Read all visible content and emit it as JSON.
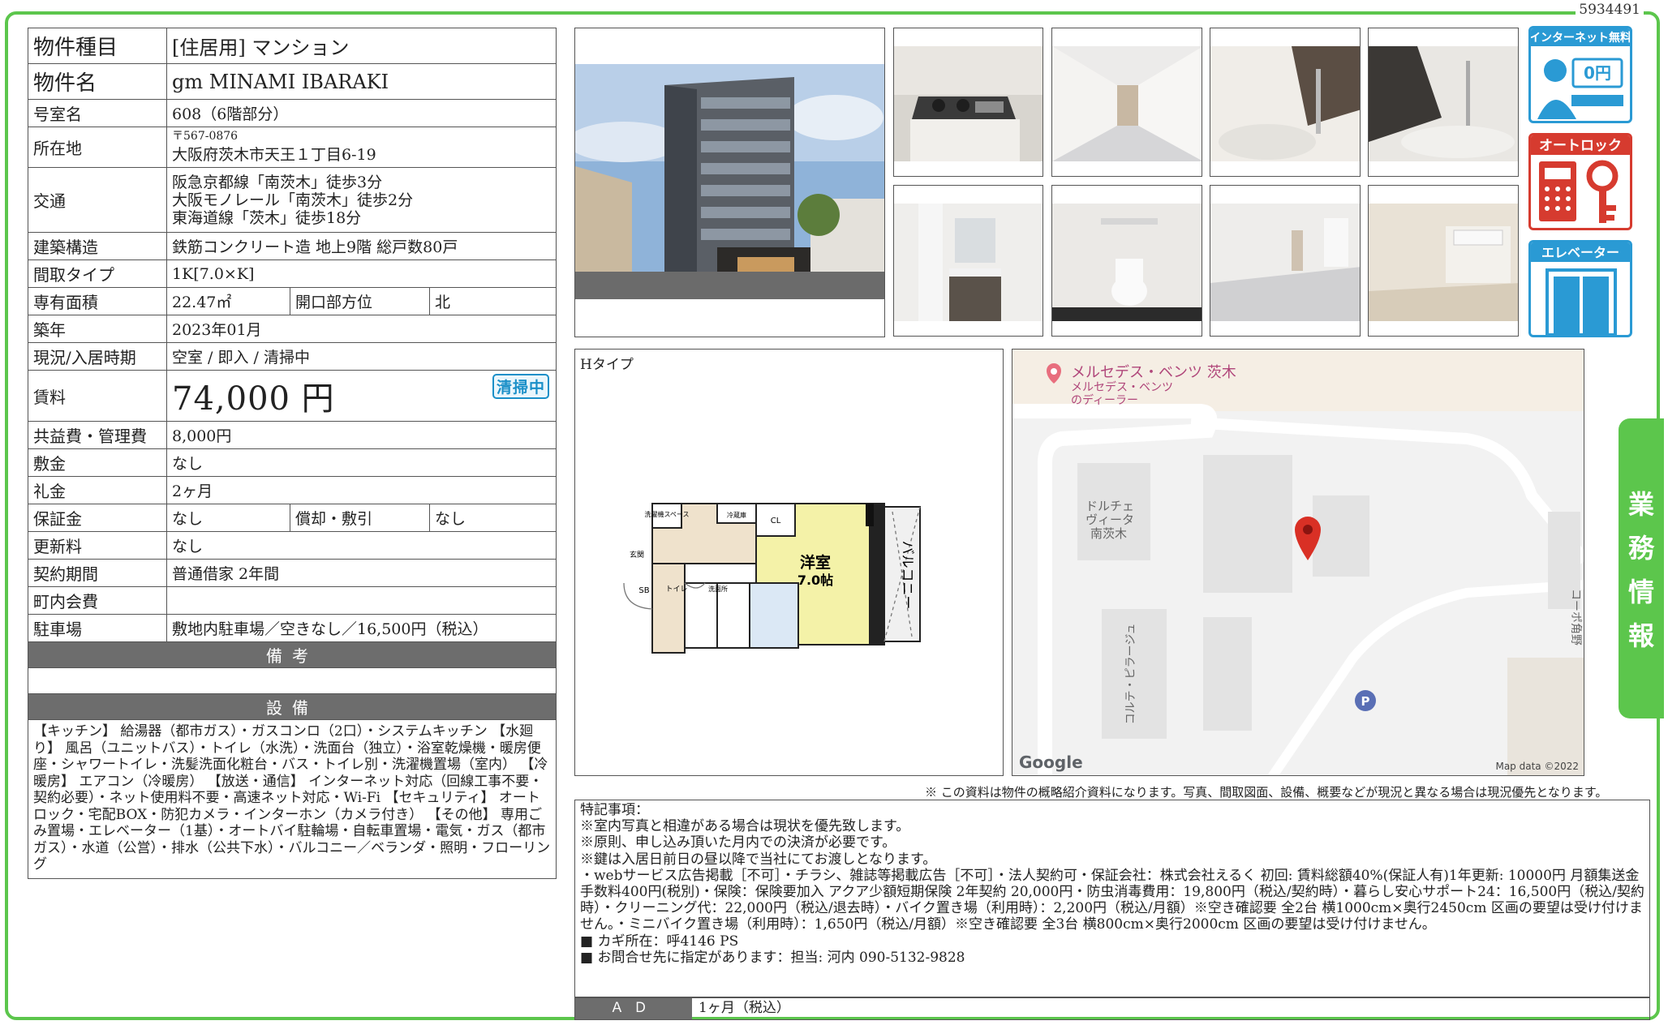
{
  "doc_id": "5934491",
  "spec": {
    "property_type": {
      "label": "物件種目",
      "value": "[住居用] マンション"
    },
    "name": {
      "label": "物件名",
      "value": "gm MINAMI IBARAKI"
    },
    "room_no": {
      "label": "号室名",
      "value": "608（6階部分）"
    },
    "address": {
      "label": "所在地",
      "zip": "〒567-0876",
      "value": "大阪府茨木市天王１丁目6-19"
    },
    "access": {
      "label": "交通",
      "lines": [
        "阪急京都線「南茨木」徒歩3分",
        "大阪モノレール「南茨木」徒歩2分",
        "東海道線「茨木」徒歩18分"
      ]
    },
    "structure": {
      "label": "建築構造",
      "value": "鉄筋コンクリート造 地上9階 総戸数80戸"
    },
    "layout": {
      "label": "間取タイプ",
      "value": "1K[7.0×K]"
    },
    "area": {
      "label": "専有面積",
      "value": "22.47㎡",
      "sub_label": "開口部方位",
      "sub_value": "北"
    },
    "built": {
      "label": "築年",
      "value": "2023年01月"
    },
    "status": {
      "label": "現況/入居時期",
      "value": "空室 / 即入 / 清掃中"
    },
    "rent": {
      "label": "賃料",
      "value": "74,000 円",
      "badge": "清掃中"
    },
    "common_fee": {
      "label": "共益費・管理費",
      "value": "8,000円"
    },
    "deposit": {
      "label": "敷金",
      "value": "なし"
    },
    "key_money": {
      "label": "礼金",
      "value": "2ヶ月"
    },
    "guarantee": {
      "label": "保証金",
      "value": "なし",
      "sub_label": "償却・敷引",
      "sub_value": "なし"
    },
    "renewal": {
      "label": "更新料",
      "value": "なし"
    },
    "contract": {
      "label": "契約期間",
      "value": "普通借家 2年間"
    },
    "community_fee": {
      "label": "町内会費",
      "value": ""
    },
    "parking": {
      "label": "駐車場",
      "value": "敷地内駐車場／空きなし／16,500円（税込）"
    },
    "remarks_header": "備考",
    "equipment_header": "設備",
    "equipment": "【キッチン】 給湯器（都市ガス）・ガスコンロ（2口）・システムキッチン 【水廻り】 風呂（ユニットバス）・トイレ（水洗）・洗面台（独立）・浴室乾燥機・暖房便座・シャワートイレ・洗髪洗面化粧台・バス・トイレ別・洗濯機置場（室内） 【冷暖房】 エアコン（冷暖房） 【放送・通信】 インターネット対応（回線工事不要・契約必要）・ネット使用料不要・高速ネット対応・Wi-Fi 【セキュリティ】 オートロック・宅配BOX・防犯カメラ・インターホン（カメラ付き） 【その他】 専用ごみ置場・エレベーター（1基）・オートバイ駐輪場・自転車置場・電気・ガス（都市ガス）・水道（公営）・排水（公共下水）・バルコニー／ベランダ・照明・フローリング"
  },
  "icons": {
    "internet": {
      "title": "インターネット無料",
      "price": "0円"
    },
    "autolock": {
      "title": "オートロック"
    },
    "elevator": {
      "title": "エレベーター"
    }
  },
  "floor_plan": {
    "type_label": "Hタイプ",
    "room_label": "洋室",
    "room_size": "7.0帖",
    "balcony": "バルコニー",
    "labels": {
      "laundry": "洗濯機スペース",
      "fridge": "冷蔵庫",
      "closet": "CL",
      "entrance": "玄関",
      "shoebox": "SB",
      "toilet": "トイレ",
      "washroom": "洗面所"
    }
  },
  "map": {
    "poi_dealer": "メルセデス・ベンツ 茨木",
    "poi_dealer_sub1": "メルセデス・ベンツ",
    "poi_dealer_sub2": "のディーラー",
    "bldg1": [
      "ドルチェ",
      "ヴィータ",
      "南茨木"
    ],
    "bldg2": "コルテ・ピラージュ",
    "bldg3": "コーポ角野",
    "google": "Google",
    "attribution": "Map data ©2022",
    "marker_color": "#d93025",
    "parking_color": "#5a6fb5"
  },
  "disclaimer": "※ この資料は物件の概略紹介資料になります。写真、間取図面、設備、概要などが現況と異なる場合は現況優先となります。",
  "notes": {
    "lines": [
      "特記事項：",
      "※室内写真と相違がある場合は現状を優先致します。",
      "※原則、申し込み頂いた月内での決済が必要です。",
      "※鍵は入居日前日の昼以降で当社にてお渡しとなります。",
      "・webサービス広告掲載［不可］・チラシ、雑誌等掲載広告［不可］・法人契約可・保証会社：株式会社えるく 初回: 賃料総額40%(保証人有)1年更新: 10000円 月額集送金手数料400円(税別)・保険：保険要加入 アクア少額短期保険 2年契約 20,000円・防虫消毒費用：19,800円（税込/契約時）・暮らし安心サポート24：16,500円（税込/契約時）・クリーニング代：22,000円（税込/退去時）・バイク置き場（利用時）：2,200円（税込/月額）※空き確認要 全2台 横1000cm×奥行2450cm 区画の要望は受け付けません。・ミニバイク置き場（利用時）：1,650円（税込/月額）※空き確認要 全3台 横800cm×奥行2000cm 区画の要望は受け付けません。",
      "■ カギ所在：呼4146 PS",
      "■ お問合せ先に指定があります：担当: 河内 090-5132-9828"
    ]
  },
  "ad": {
    "label": "ＡＤ",
    "value": "1ヶ月（税込）"
  },
  "side_tab": [
    "業",
    "務",
    "情",
    "報"
  ],
  "colors": {
    "frame_green": "#5cc64c",
    "header_gray": "#6d6d6d",
    "icon_blue": "#2a9ad4",
    "icon_red": "#d63b2f"
  }
}
